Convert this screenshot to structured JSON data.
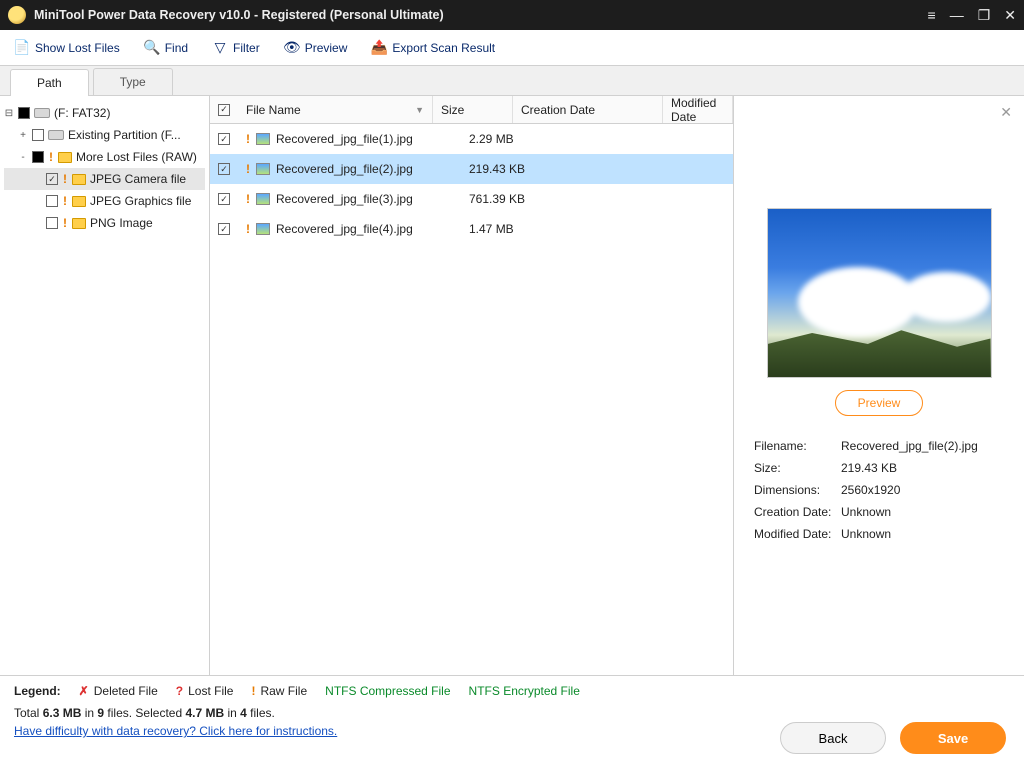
{
  "window": {
    "title": "MiniTool Power Data Recovery v10.0 - Registered (Personal Ultimate)"
  },
  "toolbar": {
    "show_lost": "Show Lost Files",
    "find": "Find",
    "filter": "Filter",
    "preview": "Preview",
    "export": "Export Scan Result"
  },
  "tabs": {
    "path": "Path",
    "type": "Type"
  },
  "tree": {
    "root": "(F: FAT32)",
    "items": [
      {
        "label": "Existing Partition (F...",
        "checked": false,
        "twisty": "+"
      },
      {
        "label": "More Lost Files (RAW)",
        "checked": "square",
        "twisty": "-"
      }
    ],
    "subitems": [
      {
        "label": "JPEG Camera file",
        "checked": true
      },
      {
        "label": "JPEG Graphics file",
        "checked": false
      },
      {
        "label": "PNG Image",
        "checked": false
      }
    ]
  },
  "columns": {
    "name": "File Name",
    "size": "Size",
    "cdate": "Creation Date",
    "mdate": "Modified Date"
  },
  "files": [
    {
      "name": "Recovered_jpg_file(1).jpg",
      "size": "2.29 MB",
      "checked": true,
      "selected": false
    },
    {
      "name": "Recovered_jpg_file(2).jpg",
      "size": "219.43 KB",
      "checked": true,
      "selected": true
    },
    {
      "name": "Recovered_jpg_file(3).jpg",
      "size": "761.39 KB",
      "checked": true,
      "selected": false
    },
    {
      "name": "Recovered_jpg_file(4).jpg",
      "size": "1.47 MB",
      "checked": true,
      "selected": false
    }
  ],
  "preview": {
    "button": "Preview",
    "meta_labels": {
      "filename": "Filename:",
      "size": "Size:",
      "dimensions": "Dimensions:",
      "creation": "Creation Date:",
      "modified": "Modified Date:"
    },
    "meta": {
      "filename": "Recovered_jpg_file(2).jpg",
      "size": "219.43 KB",
      "dimensions": "2560x1920",
      "creation": "Unknown",
      "modified": "Unknown"
    }
  },
  "legend": {
    "label": "Legend:",
    "deleted": "Deleted File",
    "lost": "Lost File",
    "raw": "Raw File",
    "ntfs_compressed": "NTFS Compressed File",
    "ntfs_encrypted": "NTFS Encrypted File"
  },
  "status": {
    "total_prefix": "Total ",
    "total_mb": "6.3 MB",
    "in1": " in ",
    "total_files": "9",
    "files_sep": " files.  Selected ",
    "sel_mb": "4.7 MB",
    "in2": " in ",
    "sel_files": "4",
    "suffix": " files."
  },
  "help_link": "Have difficulty with data recovery? Click here for instructions.",
  "buttons": {
    "back": "Back",
    "save": "Save"
  }
}
